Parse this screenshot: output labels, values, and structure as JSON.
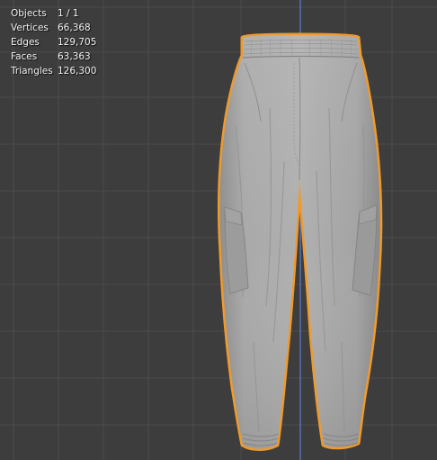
{
  "overlay": {
    "stats": [
      {
        "label": "Objects",
        "value": "1 / 1"
      },
      {
        "label": "Vertices",
        "value": "66,368"
      },
      {
        "label": "Edges",
        "value": "129,705"
      },
      {
        "label": "Faces",
        "value": "63,363"
      },
      {
        "label": "Triangles",
        "value": "126,300"
      }
    ]
  },
  "colors": {
    "background": "#3d3d3d",
    "grid_line": "#4b4b4b",
    "axis_line": "#5a78c8",
    "mesh_fill": "#a7a7a7",
    "selection_outline": "#f09a2c"
  },
  "icons": {
    "mesh": "selected-mesh-object"
  }
}
